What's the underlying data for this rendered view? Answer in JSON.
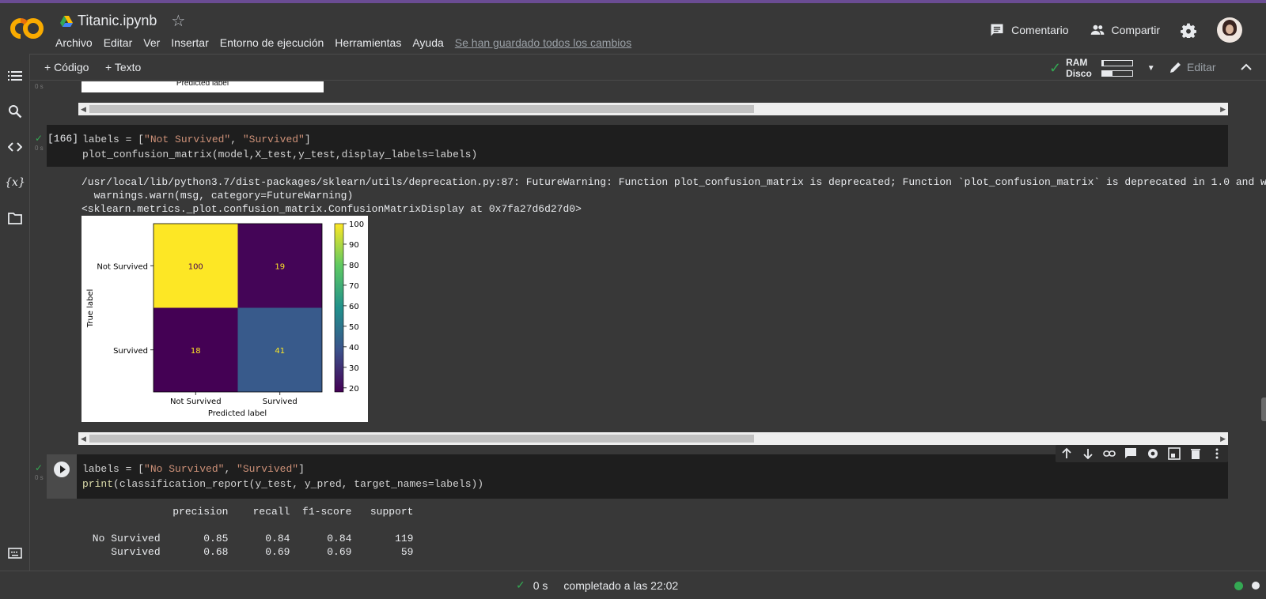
{
  "app": {
    "title": "Titanic.ipynb",
    "menu": [
      "Archivo",
      "Editar",
      "Ver",
      "Insertar",
      "Entorno de ejecución",
      "Herramientas",
      "Ayuda"
    ],
    "saved_status": "Se han guardado todos los cambios",
    "comment_label": "Comentario",
    "share_label": "Compartir"
  },
  "toolbar": {
    "add_code": "+ Código",
    "add_text": "+ Texto",
    "ram_label": "RAM",
    "disk_label": "Disco",
    "ram_level": 0.05,
    "disk_level": 0.35,
    "edit_label": "Editar"
  },
  "top_output": {
    "xlabel": "Predicted label",
    "exec_time": "0 s"
  },
  "cell166": {
    "prompt": "[166]",
    "exec_time": "0 s",
    "line1_a": "labels = [",
    "line1_s1": "\"Not Survived\"",
    "line1_sep": ", ",
    "line1_s2": "\"Survived\"",
    "line1_b": "]",
    "line2": "plot_confusion_matrix(model,X_test,y_test,display_labels=labels)",
    "warning1": "/usr/local/lib/python3.7/dist-packages/sklearn/utils/deprecation.py:87: FutureWarning: Function plot_confusion_matrix is deprecated; Function `plot_confusion_matrix` is deprecated in 1.0 and w",
    "warning2": "  warnings.warn(msg, category=FutureWarning)",
    "repr": "<sklearn.metrics._plot.confusion_matrix.ConfusionMatrixDisplay at 0x7fa27d6d27d0>"
  },
  "chart_data": {
    "type": "heatmap",
    "row_labels": [
      "Not Survived",
      "Survived"
    ],
    "col_labels": [
      "Not Survived",
      "Survived"
    ],
    "values": [
      [
        100,
        19
      ],
      [
        18,
        41
      ]
    ],
    "xlabel": "Predicted label",
    "ylabel": "True label",
    "colorbar_ticks": [
      100,
      90,
      80,
      70,
      60,
      50,
      40,
      30,
      20
    ],
    "colorbar_range": [
      18,
      100
    ],
    "colormap": "viridis"
  },
  "cell_next": {
    "exec_time": "0 s",
    "line1_a": "labels = [",
    "line1_s1": "\"No Survived\"",
    "line1_sep": ", ",
    "line1_s2": "\"Survived\"",
    "line1_b": "]",
    "line2_fn": "print",
    "line2_rest": "(classification_report(y_test, y_pred, target_names=labels))",
    "report_header": "              precision    recall  f1-score   support",
    "report_row1": " No Survived       0.85      0.84      0.84       119",
    "report_row2": "    Survived       0.68      0.69      0.69        59"
  },
  "status": {
    "time": "0 s",
    "text": "completado a las 22:02"
  },
  "colors": {
    "accent_green": "#34a853",
    "background": "#383838",
    "cell_bg": "#1e1e1e"
  }
}
